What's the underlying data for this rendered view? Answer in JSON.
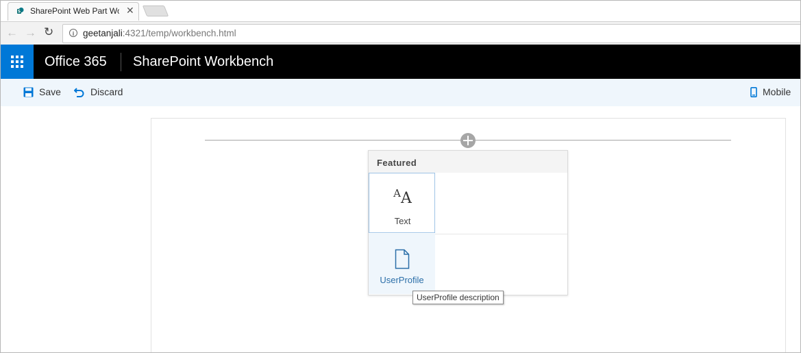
{
  "browser": {
    "tab_title": "SharePoint Web Part Wor",
    "url_host": "geetanjali",
    "url_rest": ":4321/temp/workbench.html"
  },
  "suite_bar": {
    "brand": "Office 365",
    "app_title": "SharePoint Workbench"
  },
  "command_bar": {
    "save_label": "Save",
    "discard_label": "Discard",
    "mobile_label": "Mobile"
  },
  "toolbox": {
    "header": "Featured",
    "items": [
      {
        "label": "Text",
        "icon": "font-size-icon"
      },
      {
        "label": "UserProfile",
        "icon": "page-icon"
      }
    ],
    "tooltip": "UserProfile description"
  },
  "colors": {
    "accent": "#0078d7",
    "suite_bar_bg": "#000000",
    "command_bar_bg": "#eff6fc",
    "link_blue": "#2b6ea8"
  }
}
